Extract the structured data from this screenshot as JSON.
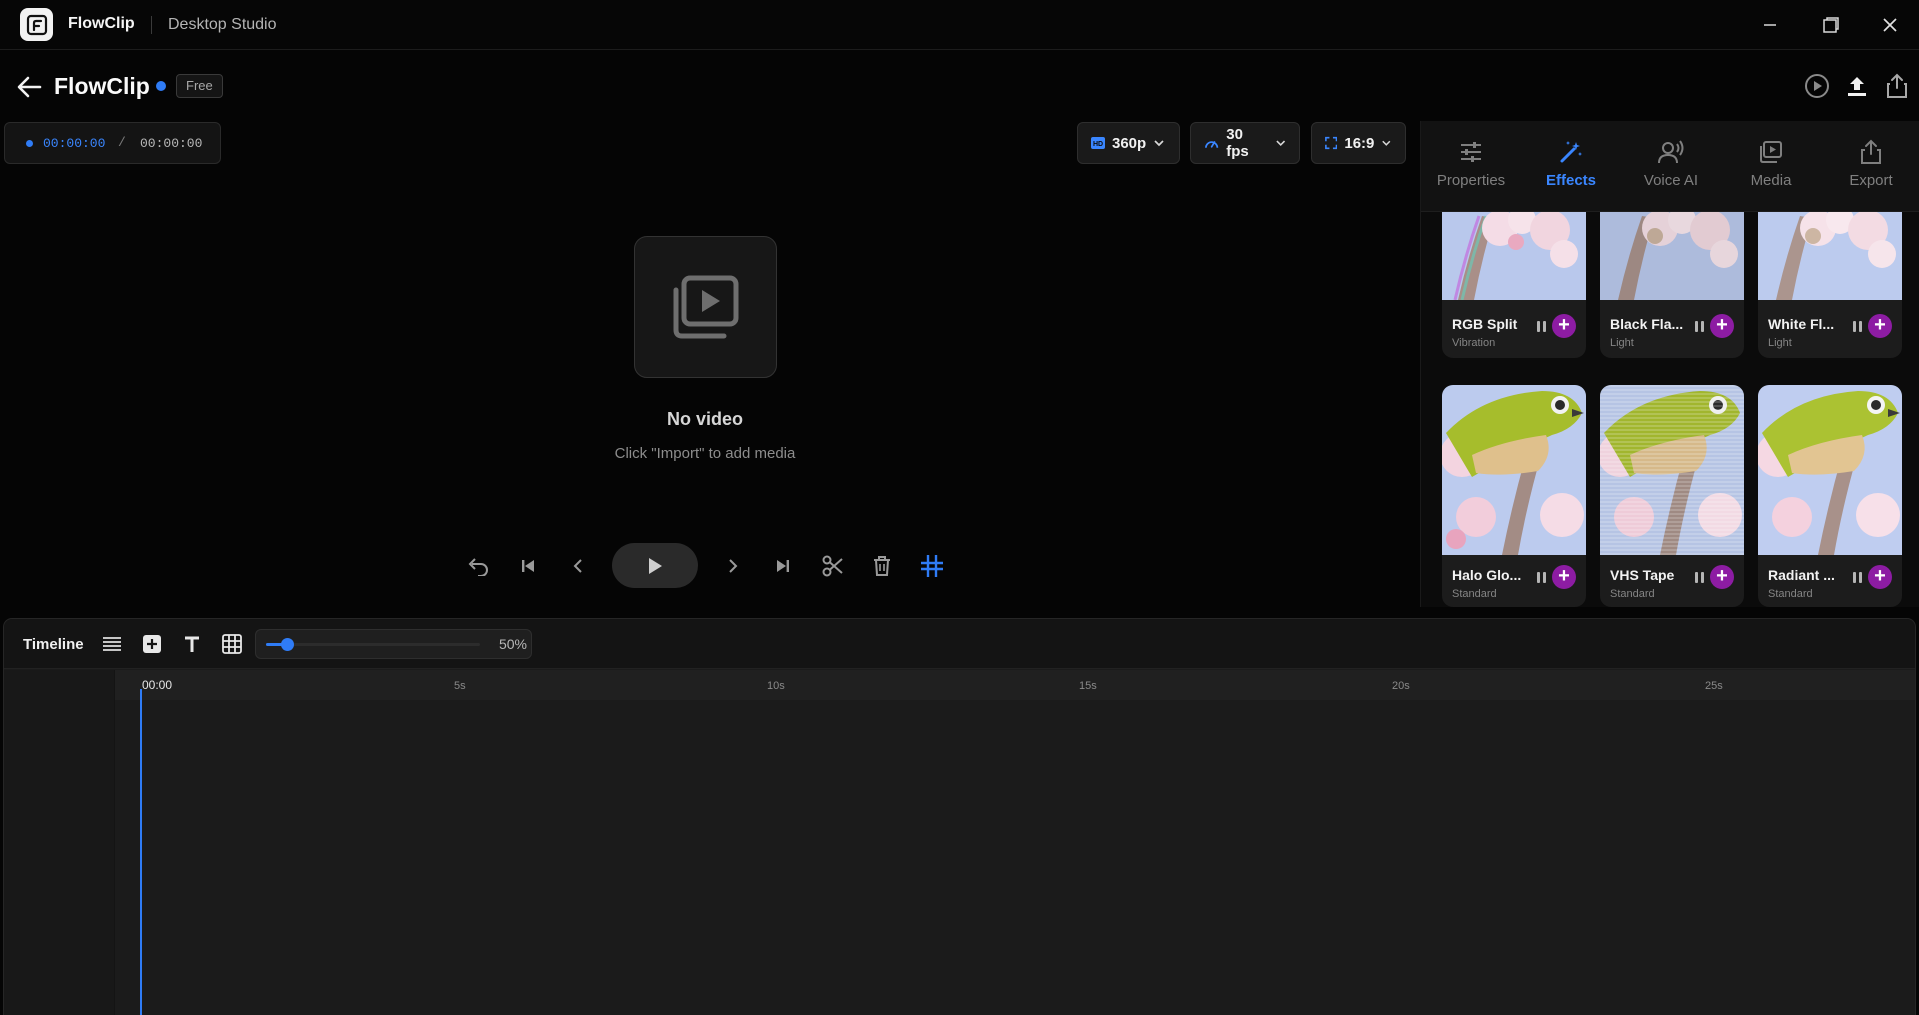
{
  "titlebar": {
    "app_name": "FlowClip",
    "subtitle": "Desktop Studio"
  },
  "header": {
    "project_title": "FlowClip",
    "plan_badge": "Free"
  },
  "timecode": {
    "current": "00:00:00",
    "separator": "/",
    "total": "00:00:00"
  },
  "settings": {
    "resolution": "360p",
    "framerate": "30 fps",
    "aspect_ratio": "16:9"
  },
  "preview": {
    "empty_title": "No video",
    "empty_hint": "Click \"Import\" to add media"
  },
  "panel": {
    "tabs": [
      {
        "label": "Properties",
        "icon": "sliders-icon"
      },
      {
        "label": "Effects",
        "icon": "magic-wand-icon",
        "active": true
      },
      {
        "label": "Voice AI",
        "icon": "voice-icon"
      },
      {
        "label": "Media",
        "icon": "media-icon"
      },
      {
        "label": "Export",
        "icon": "share-icon"
      }
    ],
    "effects": [
      {
        "title": "RGB Split",
        "category": "Vibration"
      },
      {
        "title": "Black Fla...",
        "category": "Light"
      },
      {
        "title": "White Fl...",
        "category": "Light"
      },
      {
        "title": "Halo Glo...",
        "category": "Standard"
      },
      {
        "title": "VHS Tape",
        "category": "Standard"
      },
      {
        "title": "Radiant ...",
        "category": "Standard"
      }
    ]
  },
  "timeline": {
    "title": "Timeline",
    "zoom_value": "50%",
    "zoom_fraction": 0.1,
    "ruler": [
      "00:00",
      "5s",
      "10s",
      "15s",
      "20s",
      "25s"
    ]
  },
  "colors": {
    "accent": "#2f7cf6",
    "add_button": "#8d1ca3",
    "background": "#050505"
  }
}
